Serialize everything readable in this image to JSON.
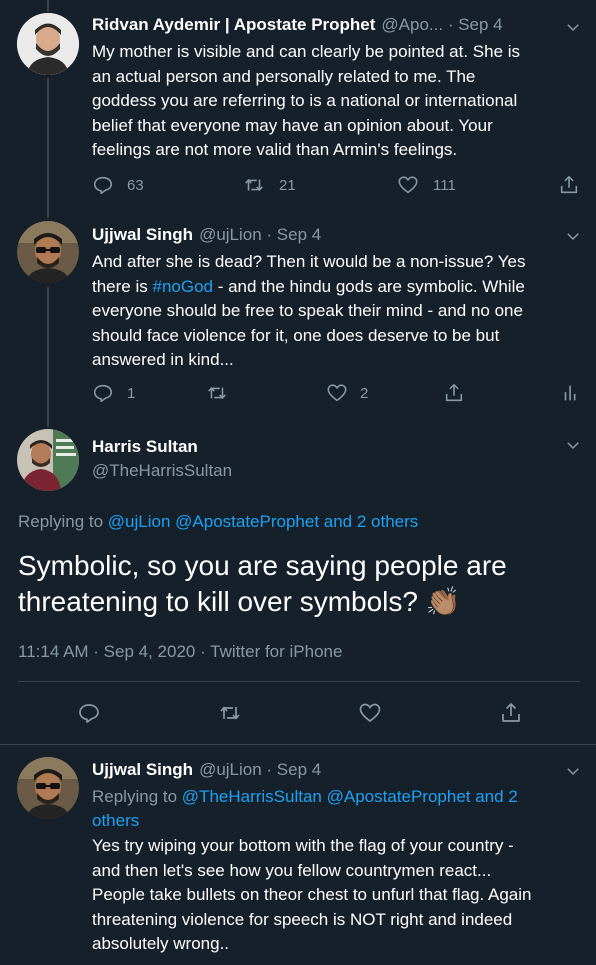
{
  "colors": {
    "background": "#15202b",
    "text": "#ffffff",
    "secondary": "#8899a6",
    "link": "#1da1f2",
    "divider": "#38444d"
  },
  "tweet1": {
    "name": "Ridvan Aydemir | Apostate Prophet",
    "handle_time": "@Apo... · Sep 4",
    "lines": [
      "My mother is visible and can clearly be pointed at. She is",
      "an actual person and personally related to me. The",
      "goddess you are referring to is a national or international",
      "belief that everyone may have an opinion about. Your",
      "feelings are not more valid than Armin's feelings."
    ],
    "replies": "63",
    "retweets": "21",
    "likes": "111"
  },
  "tweet2": {
    "name": "Ujjwal Singh",
    "handle_time": "@ujLion · Sep 4",
    "line1": "And after she is dead? Then it would be a non-issue? Yes",
    "line2_pre": "there is ",
    "line2_hashtag": "#noGod",
    "line2_post": " - and the hindu gods are symbolic. While",
    "line3": "everyone should be free to speak their mind - and no one",
    "line4": "should face violence for it, one does deserve to be but",
    "line5": "answered in kind...",
    "replies": "1",
    "likes": "2"
  },
  "main_tweet": {
    "name": "Harris Sultan",
    "handle": "@TheHarrisSultan",
    "replying_prefix": "Replying to",
    "replying_mentions": "@ujLion @ApostateProphet and 2 others",
    "line1": "Symbolic, so you are saying people are",
    "line2": "threatening to kill over symbols?",
    "emoji": "👏🏽",
    "timestamp": "11:14 AM · Sep 4, 2020 · Twitter for iPhone"
  },
  "tweet3": {
    "name": "Ujjwal Singh",
    "handle_time": "@ujLion · Sep 4",
    "replying_prefix": "Replying to",
    "replying_mentions_line1": "@TheHarrisSultan @ApostateProphet and 2",
    "replying_mentions_line2": "others",
    "lines": [
      "Yes try wiping your bottom with the flag of your country -",
      "and then let's see how you fellow countrymen react...",
      "People take bullets on theor chest to unfurl that flag. Again",
      "threatening violence for speech is NOT right and indeed",
      "absolutely wrong.."
    ]
  },
  "icons": {
    "reply": "reply-icon",
    "retweet": "retweet-icon",
    "like": "heart-icon",
    "share": "share-icon",
    "analytics": "analytics-icon",
    "caret": "chevron-down-icon"
  }
}
